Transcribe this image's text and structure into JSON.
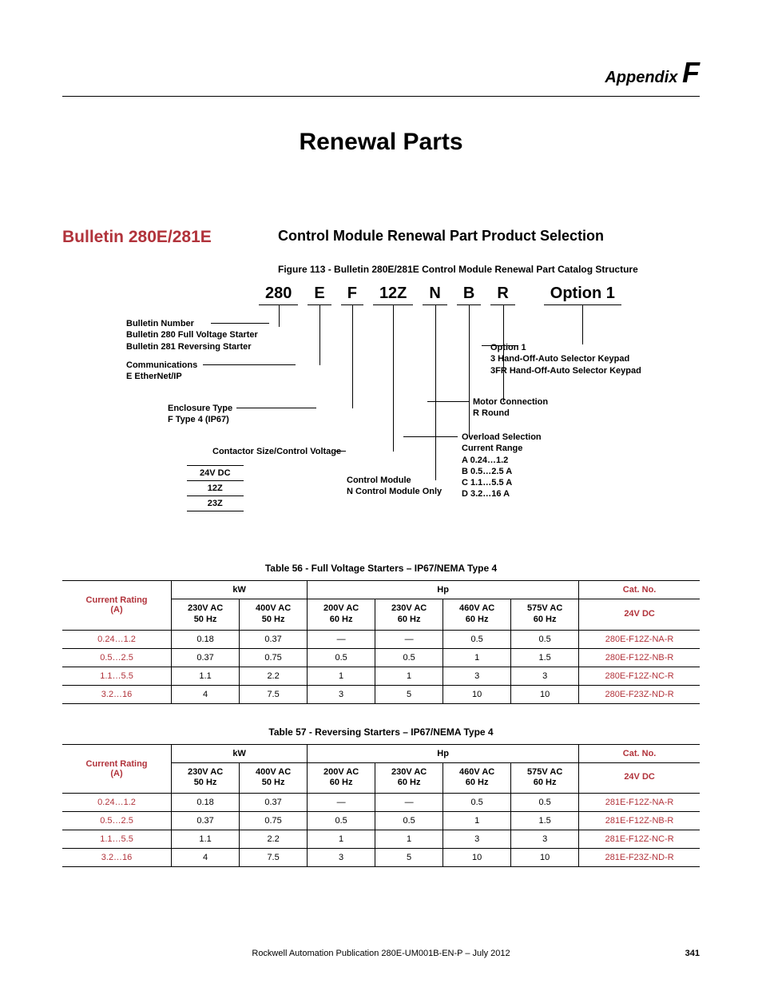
{
  "header": {
    "appendix_word": "Appendix",
    "appendix_letter": "F"
  },
  "title": "Renewal Parts",
  "section": {
    "left_heading": "Bulletin 280E/281E",
    "right_heading": "Control Module Renewal Part Product Selection",
    "figure_caption": "Figure 113 - Bulletin 280E/281E Control Module Renewal Part Catalog Structure"
  },
  "catalog": {
    "segments": [
      "280",
      "E",
      "F",
      "12Z",
      "N",
      "B",
      "R",
      "Option 1"
    ],
    "bulletin_title": "Bulletin Number",
    "bulletin_l1": "Bulletin 280 Full Voltage Starter",
    "bulletin_l2": "Bulletin 281 Reversing Starter",
    "comm_title": "Communications",
    "comm_l1": "E EtherNet/IP",
    "encl_title": "Enclosure Type",
    "encl_l1": "F Type 4 (IP67)",
    "cont_title": "Contactor Size/Control Voltage",
    "volt_rows": [
      "24V DC",
      "12Z",
      "23Z"
    ],
    "ctrl_title": "Control Module",
    "ctrl_l1": "N Control Module Only",
    "ovl_title": "Overload Selection",
    "ovl_sub": "Current Range",
    "ovl_a": "A 0.24…1.2",
    "ovl_b": "B 0.5…2.5 A",
    "ovl_c": "C 1.1…5.5 A",
    "ovl_d": "D 3.2…16 A",
    "motor_title": "Motor Connection",
    "motor_l1": "R Round",
    "opt_title": "Option 1",
    "opt_l1": "3 Hand-Off-Auto Selector Keypad",
    "opt_l2": "3FR Hand-Off-Auto Selector Keypad"
  },
  "table56": {
    "caption": "Table 56 - Full Voltage Starters – IP67/NEMA Type 4",
    "top": {
      "kw": "kW",
      "hp": "Hp",
      "cat": "Cat. No."
    },
    "cols": {
      "cr": "Current Rating\n(A)",
      "c230_50": "230V AC\n50 Hz",
      "c400_50": "400V AC\n50 Hz",
      "c200_60": "200V AC\n60 Hz",
      "c230_60": "230V AC\n60 Hz",
      "c460_60": "460V AC\n60 Hz",
      "c575_60": "575V AC\n60 Hz",
      "c24": "24V DC"
    },
    "rows": [
      [
        "0.24…1.2",
        "0.18",
        "0.37",
        "—",
        "—",
        "0.5",
        "0.5",
        "280E-F12Z-NA-R"
      ],
      [
        "0.5…2.5",
        "0.37",
        "0.75",
        "0.5",
        "0.5",
        "1",
        "1.5",
        "280E-F12Z-NB-R"
      ],
      [
        "1.1…5.5",
        "1.1",
        "2.2",
        "1",
        "1",
        "3",
        "3",
        "280E-F12Z-NC-R"
      ],
      [
        "3.2…16",
        "4",
        "7.5",
        "3",
        "5",
        "10",
        "10",
        "280E-F23Z-ND-R"
      ]
    ]
  },
  "table57": {
    "caption": "Table 57 - Reversing Starters – IP67/NEMA Type 4",
    "rows": [
      [
        "0.24…1.2",
        "0.18",
        "0.37",
        "—",
        "—",
        "0.5",
        "0.5",
        "281E-F12Z-NA-R"
      ],
      [
        "0.5…2.5",
        "0.37",
        "0.75",
        "0.5",
        "0.5",
        "1",
        "1.5",
        "281E-F12Z-NB-R"
      ],
      [
        "1.1…5.5",
        "1.1",
        "2.2",
        "1",
        "1",
        "3",
        "3",
        "281E-F12Z-NC-R"
      ],
      [
        "3.2…16",
        "4",
        "7.5",
        "3",
        "5",
        "10",
        "10",
        "281E-F23Z-ND-R"
      ]
    ]
  },
  "footer": {
    "pub": "Rockwell Automation Publication 280E-UM001B-EN-P – July 2012",
    "page": "341"
  }
}
